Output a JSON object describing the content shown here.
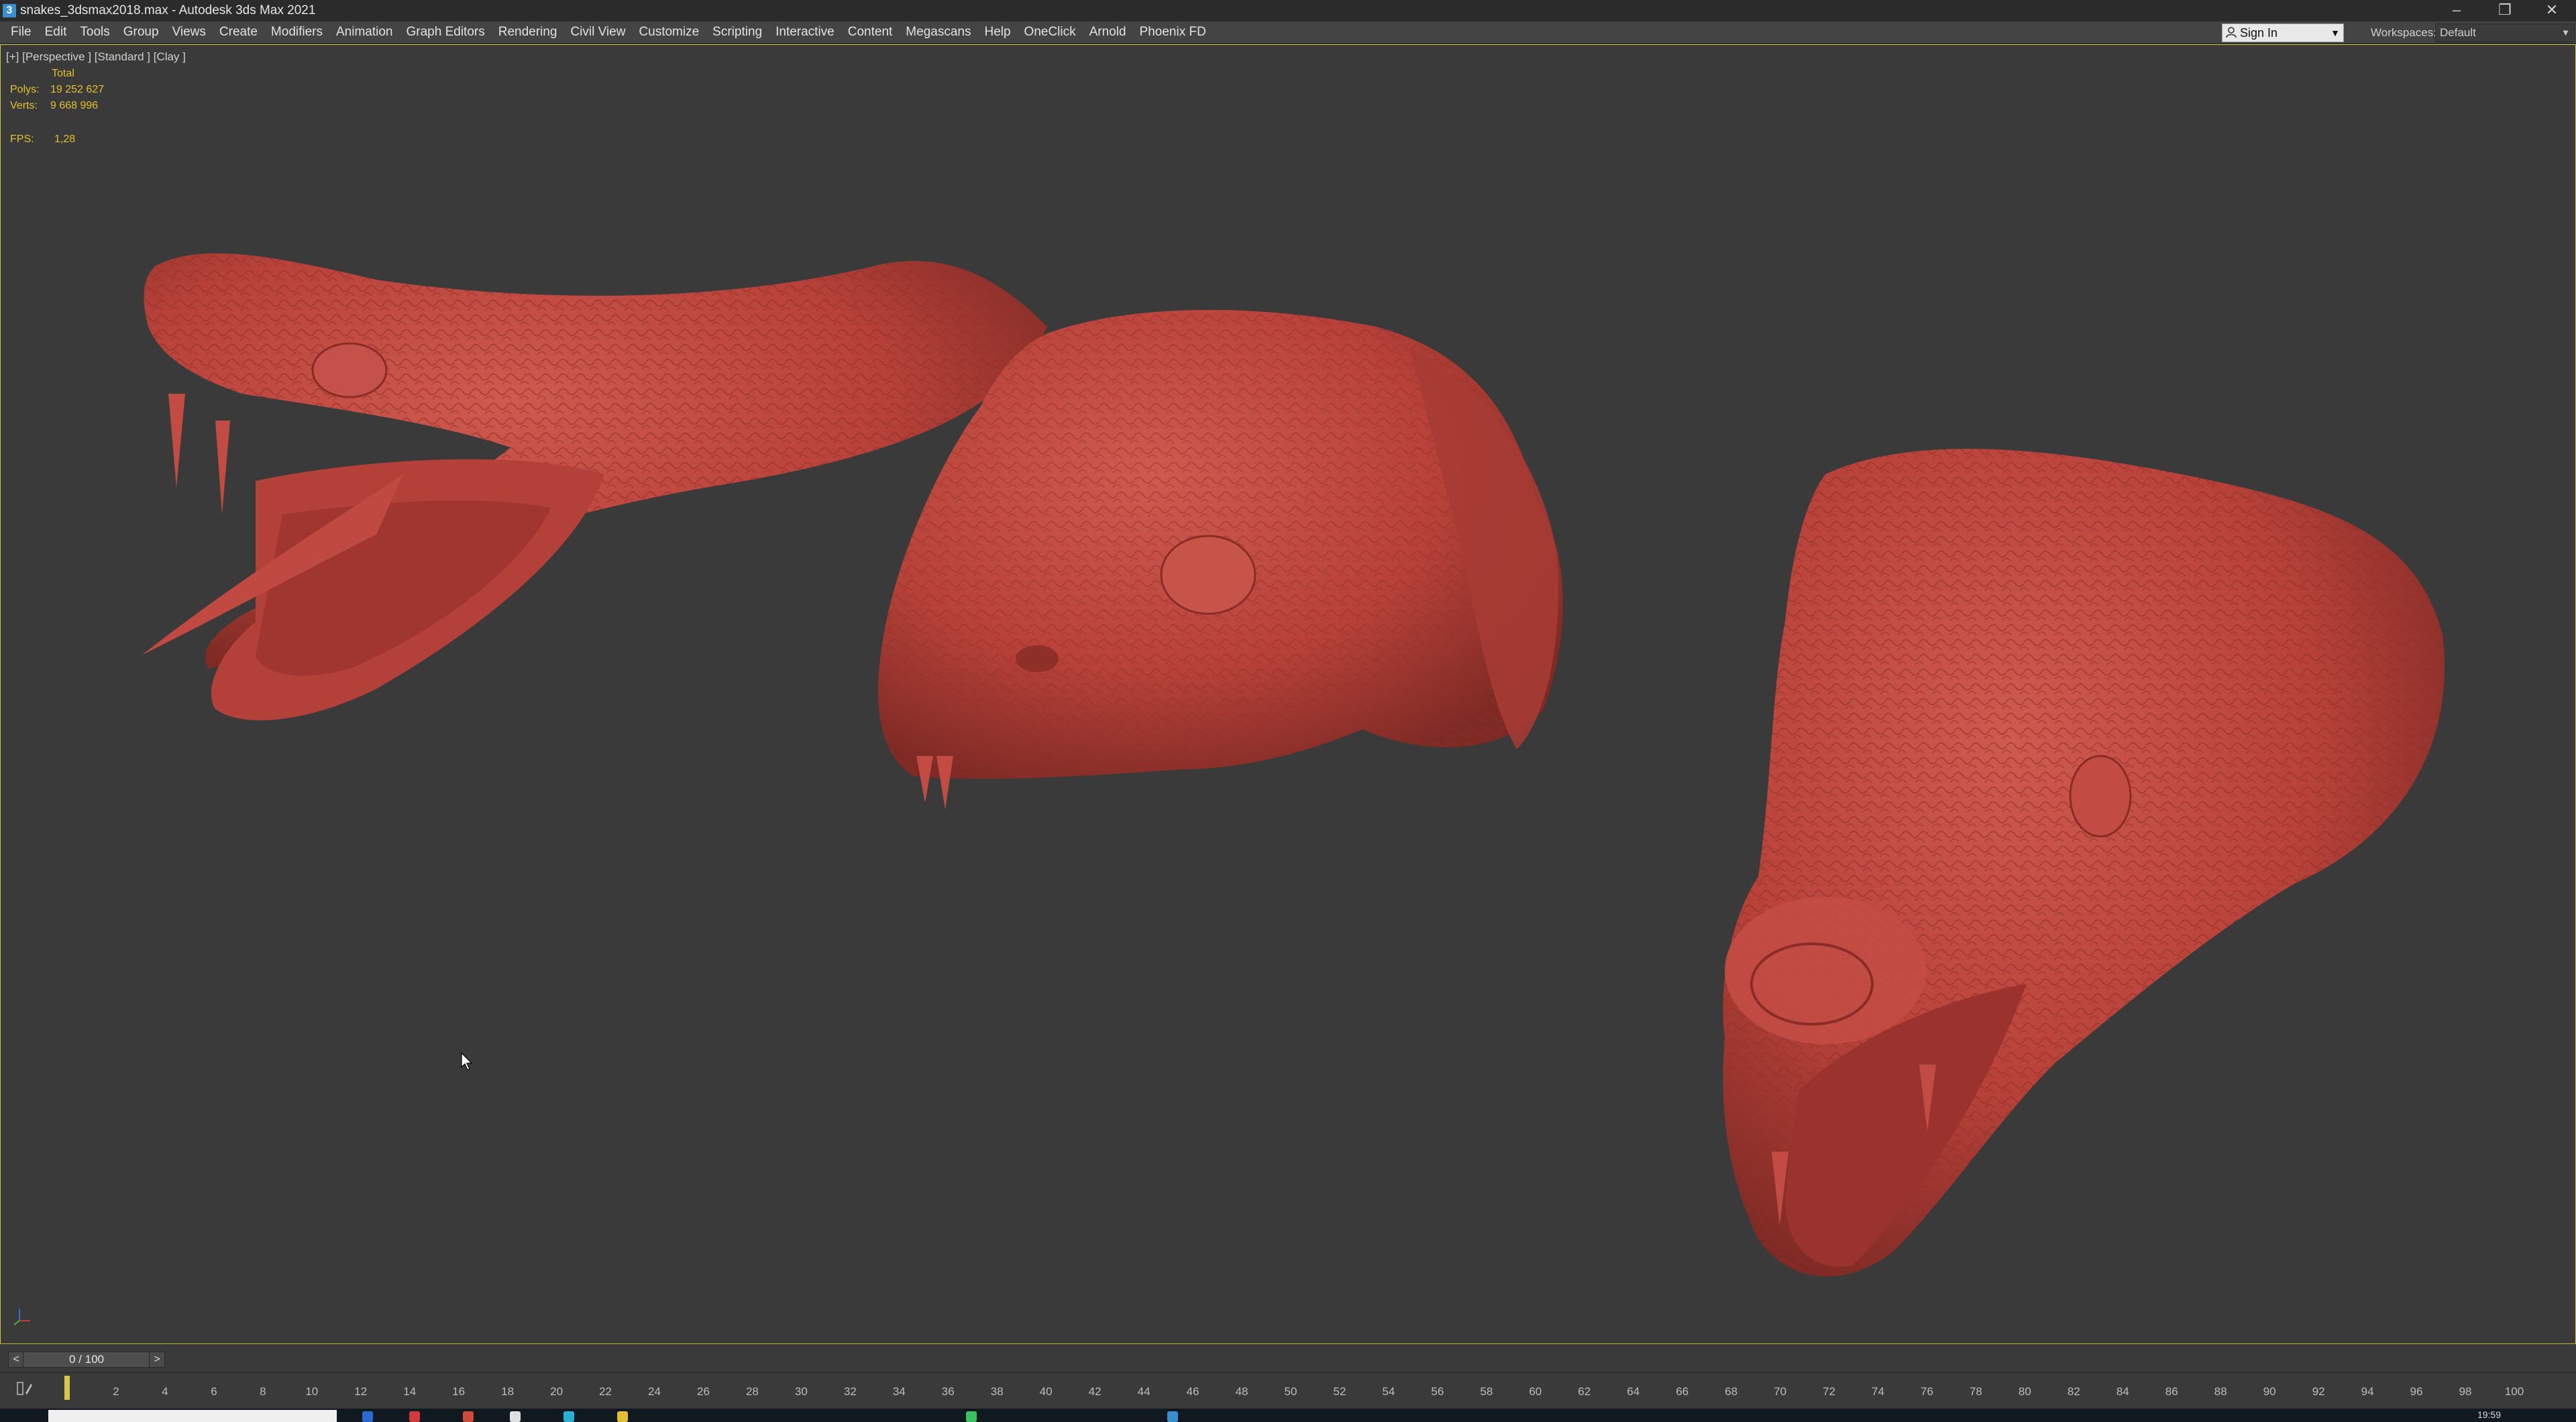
{
  "titlebar": {
    "app_icon": "3ds-max-icon",
    "title": "snakes_3dsmax2018.max - Autodesk 3ds Max 2021",
    "controls": {
      "minimize": "–",
      "restore": "❐",
      "close": "✕"
    }
  },
  "menubar": {
    "items": [
      "File",
      "Edit",
      "Tools",
      "Group",
      "Views",
      "Create",
      "Modifiers",
      "Animation",
      "Graph Editors",
      "Rendering",
      "Civil View",
      "Customize",
      "Scripting",
      "Interactive",
      "Content",
      "Megascans",
      "Help",
      "OneClick",
      "Arnold",
      "Phoenix FD"
    ],
    "sign_in": "Sign In",
    "workspaces_label": "Workspaces:",
    "workspaces_value": "Default"
  },
  "viewport": {
    "label": "[+] [Perspective ] [Standard ] [Clay ]",
    "stats": {
      "total_label": "Total",
      "polys_label": "Polys:",
      "polys_value": "19 252 627",
      "verts_label": "Verts:",
      "verts_value": "9 668 996",
      "fps_label": "FPS:",
      "fps_value": "1,28"
    },
    "model_color": "#b8423a",
    "active_border_color": "#d1c34a"
  },
  "timeline": {
    "frame_display": "0 / 100",
    "prev_label": "<",
    "next_label": ">",
    "current_frame": 0,
    "ticks": [
      "2",
      "4",
      "6",
      "8",
      "10",
      "12",
      "14",
      "16",
      "18",
      "20",
      "22",
      "24",
      "26",
      "28",
      "30",
      "32",
      "34",
      "36",
      "38",
      "40",
      "42",
      "44",
      "46",
      "48",
      "50",
      "52",
      "54",
      "56",
      "58",
      "60",
      "62",
      "64",
      "66",
      "68",
      "70",
      "72",
      "74",
      "76",
      "78",
      "80",
      "82",
      "84",
      "86",
      "88",
      "90",
      "92",
      "94",
      "96",
      "98",
      "100"
    ]
  },
  "taskbar": {
    "clock": "19:59"
  }
}
